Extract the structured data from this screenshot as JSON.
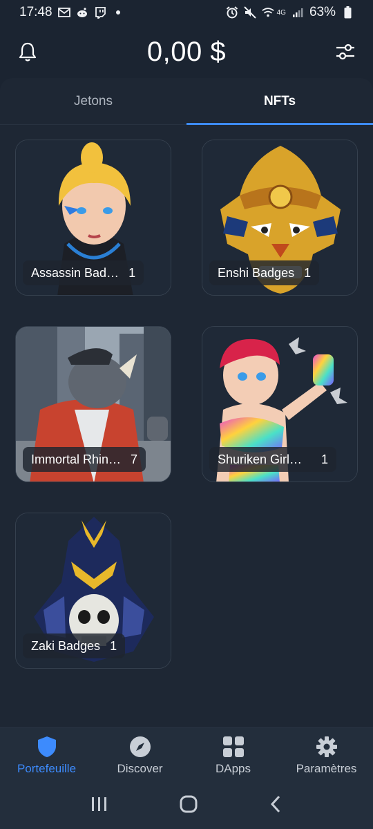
{
  "status_bar": {
    "time": "17:48",
    "battery": "63%",
    "network": "4G",
    "left_icons": [
      "gmail-icon",
      "reddit-icon",
      "twitch-icon",
      "dot-icon"
    ],
    "right_icons": [
      "alarm-icon",
      "mute-icon",
      "wifi-icon",
      "signal-icon",
      "battery-icon"
    ]
  },
  "header": {
    "balance": "0,00 $",
    "left_icon": "bell-icon",
    "right_icon": "filter-sliders-icon"
  },
  "tabs": [
    {
      "label": "Jetons",
      "active": false
    },
    {
      "label": "NFTs",
      "active": true
    }
  ],
  "nfts": [
    {
      "name": "Assassin Bad…",
      "count": "1",
      "art": "blonde-assassin-girl"
    },
    {
      "name": "Enshi Badges",
      "count": "1",
      "art": "golden-samurai-mask"
    },
    {
      "name": "Immortal Rhin…",
      "count": "7",
      "art": "rhino-in-city"
    },
    {
      "name": "Shuriken Girl…",
      "count": "1",
      "art": "shuriken-girl"
    },
    {
      "name": "Zaki Badges",
      "count": "1",
      "art": "skull-samurai"
    }
  ],
  "bottom_nav": [
    {
      "label": "Portefeuille",
      "icon": "shield-icon",
      "active": true
    },
    {
      "label": "Discover",
      "icon": "compass-icon",
      "active": false
    },
    {
      "label": "DApps",
      "icon": "grid-icon",
      "active": false
    },
    {
      "label": "Paramètres",
      "icon": "gear-icon",
      "active": false
    }
  ],
  "colors": {
    "background": "#1b2431",
    "panel": "#1e2734",
    "accent": "#3d8bfd",
    "nav_background": "#232e3c"
  }
}
